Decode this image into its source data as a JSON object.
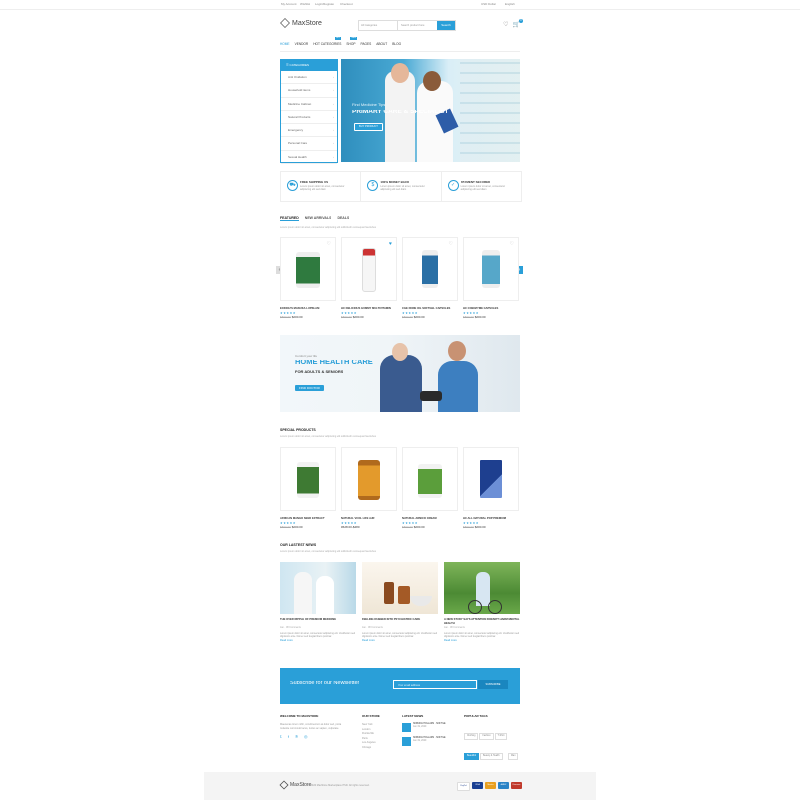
{
  "topbar": {
    "links": [
      "My Account",
      "Wishlist",
      "Login/Register",
      "Checkout"
    ],
    "currency": "USD Dollar",
    "language": "English"
  },
  "header": {
    "logo": "MaxStore",
    "category_select": "All Categories",
    "search_placeholder": "Search product here",
    "search_button": "Search",
    "cart_count": "0"
  },
  "nav": {
    "items": [
      "HOME",
      "VENDOR",
      "HOT CATEGORIES",
      "SHOP",
      "PAGES",
      "ABOUT",
      "BLOG"
    ],
    "badges": {
      "hot": "HOT",
      "shop": "NEW"
    }
  },
  "categories": {
    "title": "CATEGORIES",
    "items": [
      "Anti Oxidation",
      "Household items",
      "Medicine Cabinet",
      "Natural Products",
      "Emergency",
      "Personal Care",
      "Sexual Health"
    ]
  },
  "hero": {
    "subtitle": "Find Medicine Tips",
    "title": "PRIMARY CARE & SPECIALIST",
    "button": "BUY PRODUCT"
  },
  "features": [
    {
      "title": "FREE SHIPPING US",
      "desc": "Lorem ipsum dolor sit amet, consectetur adipiscing elit sed diam"
    },
    {
      "title": "100% MONEY BACK",
      "desc": "Lorem ipsum dolor sit amet, consectetur adipiscing elit sed diam"
    },
    {
      "title": "PAYMENT SECURED",
      "desc": "Lorem ipsum dolor sit amet, consectetur adipiscing elit sed diam"
    }
  ],
  "product_tabs": {
    "tabs": [
      "FEATURED",
      "NEW ARRIVALS",
      "DEALS"
    ],
    "subtitle": "Lorem ipsum dolor sit amet, consectetur adipiscing elit sollicitudin consequat fauciubus"
  },
  "featured_products": [
    {
      "name": "EODICH'S MANUKA LUPIN-AM",
      "stars": "★★★★★",
      "old_price": "$890.00",
      "price": "$200.00"
    },
    {
      "name": "HC DELICIOUS GUMMY MULTIVITAMIN",
      "stars": "★★★★★",
      "old_price": "$890.00",
      "price": "$200.00"
    },
    {
      "name": "CGE DODE OIL SOFTGEL CAPSULES",
      "stars": "★★★★★",
      "old_price": "$890.00",
      "price": "$200.00"
    },
    {
      "name": "HC COENZYME CAPSULES",
      "stars": "★★★★★",
      "old_price": "$890.00",
      "price": "$200.00"
    }
  ],
  "promo": {
    "small": "Comfort your life",
    "title": "HOME HEALTH CARE",
    "subtitle": "FOR ADULTS & SENIORS",
    "button": "FIND DOCTOR"
  },
  "special": {
    "title": "SPECIAL PRODUCTS",
    "subtitle": "Lorem ipsum dolor sit amet, consectetur adipiscing elit sollicitudin consequat fauciubus",
    "products": [
      {
        "name": "AFRICAN MANGO SEED EXTRACT",
        "stars": "★★★★★",
        "old_price": "$890.00",
        "price": "$200.00"
      },
      {
        "name": "NATURAL VCOL LIFE AJR",
        "stars": "★★★★★",
        "old_price": "",
        "price": "#628.00-$480"
      },
      {
        "name": "NATURAL ARNICO CREAM",
        "stars": "★★★★★",
        "old_price": "$890.00",
        "price": "$200.00"
      },
      {
        "name": "HC ALL NATURAL POP PREMIUM",
        "stars": "★★★★★",
        "old_price": "$890.00",
        "price": "$200.00"
      }
    ]
  },
  "news": {
    "title": "OUR LASTEST NEWS",
    "subtitle": "Lorem ipsum dolor sit amet, consectetur adipiscing elit sollicitudin consequat fauciubus",
    "posts": [
      {
        "title": "THE OVER RIPPLE OF PREMIUM MEDICINE",
        "meta": "Jan · 08 Comments",
        "excerpt": "Lorem ipsum dolor sit amet, consectetur adipiscing elit. Vestibulum sed dignissim ante. Donec sed feugiat libero pulvinar.",
        "more": "Read more"
      },
      {
        "title": "FEELING DUBBED INTO PSYCHIATRIC CARE",
        "meta": "Jan · 08 Comments",
        "excerpt": "Lorem ipsum dolor sit amet, consectetur adipiscing elit. Vestibulum sed dignissim ante. Donec sed feugiat libero pulvinar.",
        "more": "Read more"
      },
      {
        "title": "A NEW STUDY SAYS ATTENTION DOESN'T HARM MENTAL HEALTH",
        "meta": "Jan · 08 Comments",
        "excerpt": "Lorem ipsum dolor sit amet, consectetur adipiscing elit. Vestibulum sed dignissim ante. Donec sed feugiat libero pulvinar.",
        "more": "Read more"
      }
    ]
  },
  "newsletter": {
    "title": "Subscribe for our Newsletter",
    "placeholder": "Your email address",
    "button": "SUBSCRIBE"
  },
  "footer": {
    "welcome_title": "WELCOME TO MAXSTORE",
    "welcome_text": "Maecenas lorem nibh, condimentum at dolor sed, porta molestie commodo lacus, luctus ac sapien, vulputate.",
    "our_store_title": "OUR STORE",
    "our_store_links": [
      "New York",
      "London",
      "Florida NE",
      "Paris",
      "Los Angeles",
      "Chicago"
    ],
    "latest_news_title": "LATEST NEWS",
    "latest_news_items": [
      {
        "title": "NOBUNA HOLLARS · SOFTGE",
        "date": "Jan 19, 2020"
      },
      {
        "title": "NOBUNA HOLLARS · SOFTGE",
        "date": "Jan 19, 2020"
      }
    ],
    "tags_title": "POPULAR TAGS",
    "tags": [
      "Clothing",
      "Fashion",
      "T-Shirt",
      "Beautiful",
      "Beauty & Health",
      "Man",
      "Sneakers",
      "Accessories"
    ]
  },
  "bottom": {
    "logo": "MaxStore",
    "copyright": "© 2020 MaxStore Marketplace PSD. All rights reserved.",
    "payments": [
      "PayPal",
      "VISA",
      "Master",
      "AMEX",
      "Discover"
    ]
  },
  "colors": {
    "accent": "#2a9fd8"
  }
}
